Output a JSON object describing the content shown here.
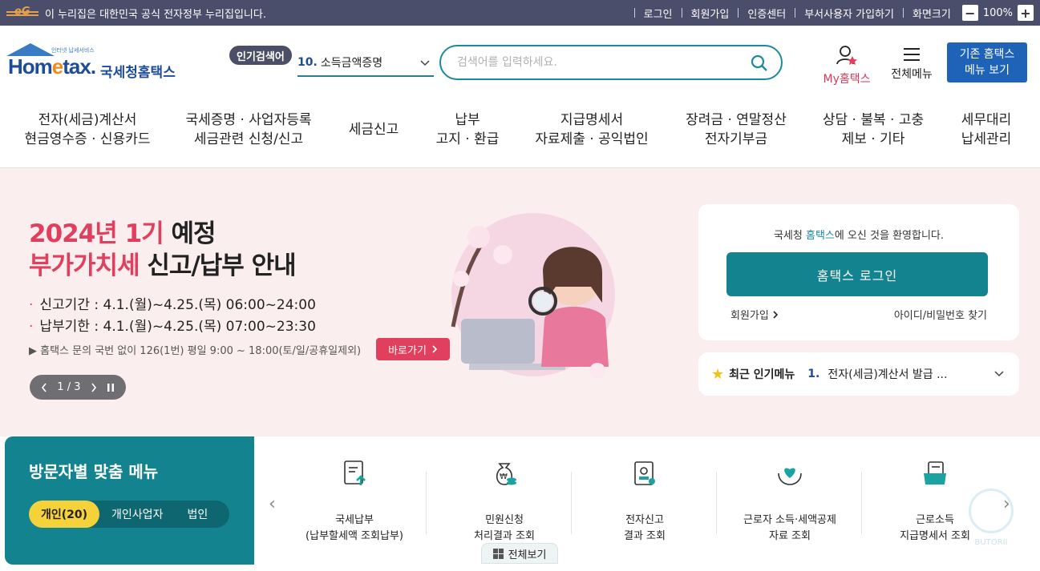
{
  "govbar": {
    "logo_text": "eG",
    "notice": "이 누리집은 대한민국 공식 전자정부 누리집입니다.",
    "links": [
      "로그인",
      "회원가입",
      "인증센터",
      "부서사용자 가입하기",
      "화면크기"
    ],
    "zoom_minus": "−",
    "zoom_level": "100%",
    "zoom_plus": "+"
  },
  "header": {
    "logo_small": "인터넷 납세서비스",
    "logo_main_a": "Hom",
    "logo_main_e": "e",
    "logo_main_b": "tax.",
    "logo_kname": "국세청홈택스",
    "popular_badge": "인기검색어",
    "popular_num": "10.",
    "popular_value": "소득금액증명",
    "search_placeholder": "검색어를 입력하세요.",
    "my_prefix": "My",
    "my_label": "홈택스",
    "all_menu": "전체메뉴",
    "old_hometax_line1": "기존 홈택스",
    "old_hometax_line2": "메뉴 보기"
  },
  "nav": [
    {
      "l1": "전자(세금)계산서",
      "l2": "현금영수증 · 신용카드"
    },
    {
      "l1": "국세증명 · 사업자등록",
      "l2": "세금관련 신청/신고"
    },
    {
      "l1": "세금신고",
      "l2": ""
    },
    {
      "l1": "납부",
      "l2": "고지 · 환급"
    },
    {
      "l1": "지급명세서",
      "l2": "자료제출 · 공익법인"
    },
    {
      "l1": "장려금 · 연말정산",
      "l2": "전자기부금"
    },
    {
      "l1": "상담 · 불복 · 고충",
      "l2": "제보 · 기타"
    },
    {
      "l1": "세무대리",
      "l2": "납세관리"
    }
  ],
  "hero": {
    "title_red1": "2024년 1기",
    "title_black1": " 예정",
    "title_red2": "부가가치세",
    "title_black2": " 신고/납부 안내",
    "bullet1": "신고기간 : 4.1.(월)~4.25.(목) 06:00~24:00",
    "bullet2": "납부기한 : 4.1.(월)~4.25.(목) 07:00~23:30",
    "note": "▶ 홈택스 문의 국번 없이 126(1번) 평일 9:00 ~ 18:00(토/일/공휴일제외)",
    "go_button": "바로가기",
    "pager": "1 / 3"
  },
  "login": {
    "welcome_a": "국세청 ",
    "welcome_b": "홈택스",
    "welcome_c": "에 오신 것을 환영합니다.",
    "login_button": "홈택스 로그인",
    "join": "회원가입",
    "find": "아이디/비밀번호 찾기"
  },
  "recent": {
    "title": "최근 인기메뉴",
    "num": "1.",
    "value": "전자(세금)계산서 발급 ..."
  },
  "visitor": {
    "title": "방문자별 맞춤 메뉴",
    "tabs": [
      "개인(20)",
      "개인사업자",
      "법인"
    ]
  },
  "quick": {
    "items": [
      {
        "l1": "국세납부",
        "l2": "(납부할세액 조회납부)"
      },
      {
        "l1": "민원신청",
        "l2": "처리결과 조회"
      },
      {
        "l1": "전자신고",
        "l2": "결과 조회"
      },
      {
        "l1": "근로자 소득·세액공제",
        "l2": "자료 조회"
      },
      {
        "l1": "근로소득",
        "l2": "지급명세서 조회"
      }
    ],
    "all_view": "전체보기",
    "chatbot": "BUTORII"
  },
  "colors": {
    "teal": "#13848f",
    "accent_red": "#e0405e",
    "govbar": "#4a4e6b",
    "hero_bg": "#fbeeef",
    "blue": "#1e63b8"
  }
}
